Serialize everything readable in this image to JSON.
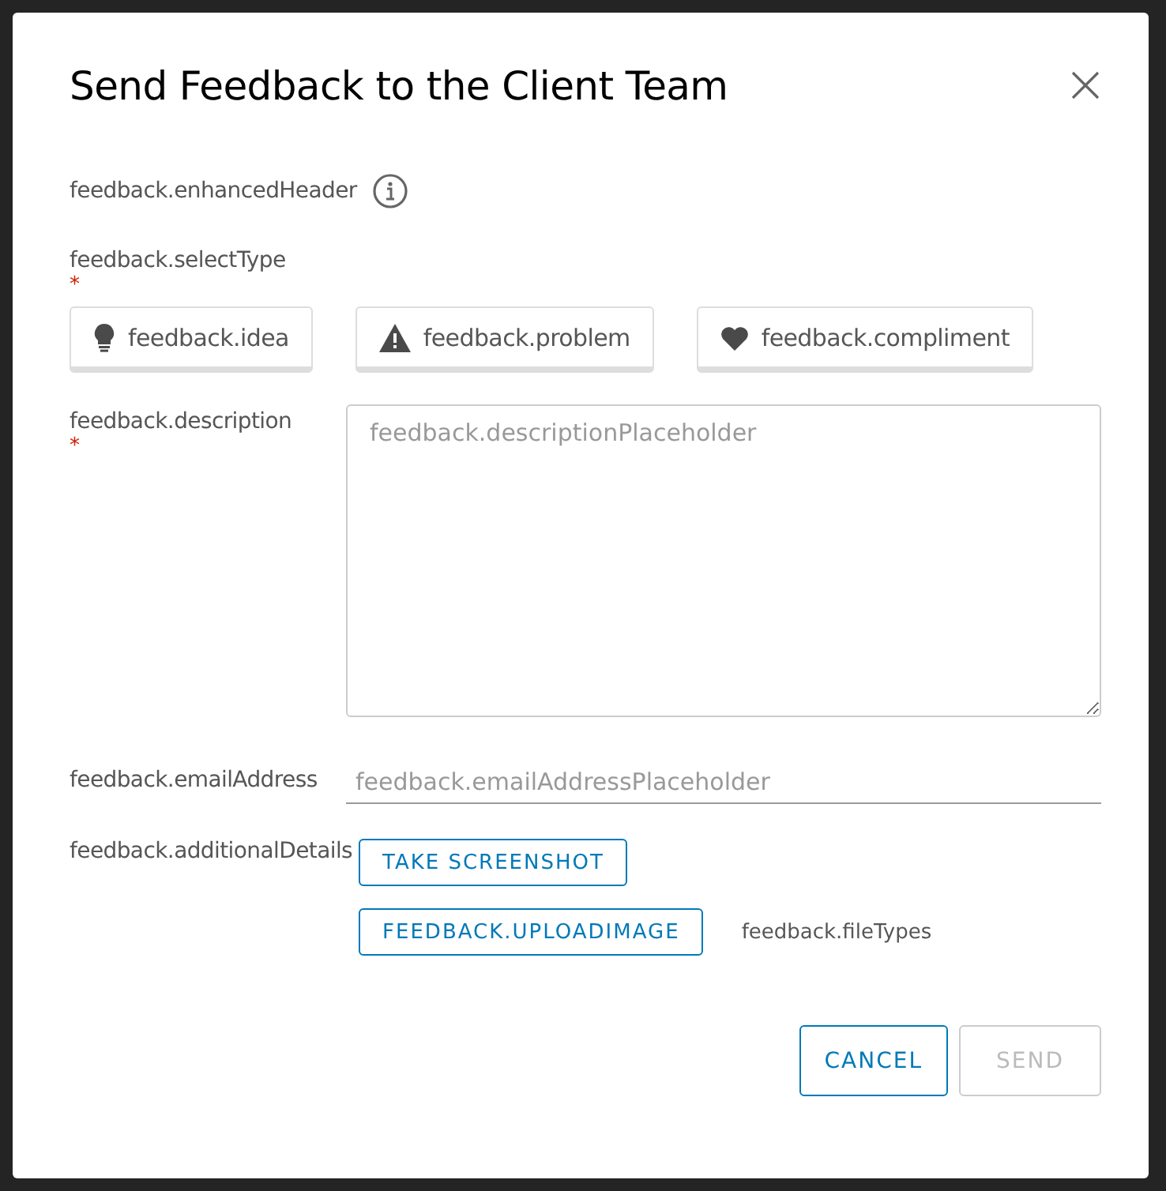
{
  "dialog": {
    "title": "Send Feedback to the Client Team",
    "header": "feedback.enhancedHeader",
    "type_label": "feedback.selectType",
    "type_required": "*",
    "types": [
      {
        "kind": "idea",
        "label": "feedback.idea",
        "selected": false
      },
      {
        "kind": "problem",
        "label": "feedback.problem",
        "selected": false
      },
      {
        "kind": "compliment",
        "label": "feedback.compliment",
        "selected": false
      }
    ],
    "description_label": "feedback.description",
    "description_required": "*",
    "description": {
      "placeholder": "feedback.descriptionPlaceholder"
    },
    "email_label": "feedback.emailAddress",
    "email": {
      "placeholder": "feedback.emailAddressPlaceholder"
    },
    "details_label": "feedback.additionalDetails",
    "screenshot_button": "TAKE SCREENSHOT",
    "upload_button": "FEEDBACK.UPLOADIMAGE",
    "file_types": "feedback.fileTypes",
    "actions": [
      {
        "label": "CANCEL",
        "disabled": false
      },
      {
        "label": "SEND",
        "disabled": true
      }
    ]
  }
}
